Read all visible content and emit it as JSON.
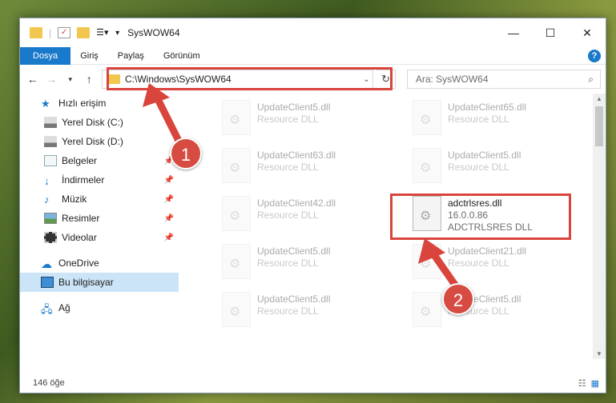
{
  "window": {
    "title": "SysWOW64"
  },
  "ribbon": {
    "tabs": [
      "Dosya",
      "Giriş",
      "Paylaş",
      "Görünüm"
    ]
  },
  "address": {
    "path": "C:\\Windows\\SysWOW64"
  },
  "search": {
    "placeholder": "Ara: SysWOW64"
  },
  "sidebar": {
    "items": [
      {
        "label": "Hızlı erişim",
        "icon": "star-icon"
      },
      {
        "label": "Yerel Disk (C:)",
        "icon": "drive-icon"
      },
      {
        "label": "Yerel Disk (D:)",
        "icon": "drive-icon"
      },
      {
        "label": "Belgeler",
        "icon": "document-icon"
      },
      {
        "label": "İndirmeler",
        "icon": "download-icon"
      },
      {
        "label": "Müzik",
        "icon": "music-icon"
      },
      {
        "label": "Resimler",
        "icon": "pictures-icon"
      },
      {
        "label": "Videolar",
        "icon": "video-icon"
      },
      {
        "label": "OneDrive",
        "icon": "cloud-icon"
      },
      {
        "label": "Bu bilgisayar",
        "icon": "computer-icon"
      },
      {
        "label": "Ağ",
        "icon": "network-icon"
      }
    ]
  },
  "files": [
    {
      "name": "UpdateClient5.dll",
      "desc": "Resource DLL"
    },
    {
      "name": "UpdateClient65.dll",
      "desc": "Resource DLL"
    },
    {
      "name": "UpdateClient63.dll",
      "desc": "Resource DLL"
    },
    {
      "name": "UpdateClient5.dll",
      "desc": "Resource DLL"
    },
    {
      "name": "UpdateClient42.dll",
      "desc": "Resource DLL"
    },
    {
      "name": "adctrlsres.dll",
      "version": "16.0.0.86",
      "desc": "ADCTRLSRES DLL"
    },
    {
      "name": "UpdateClient5.dll",
      "desc": "Resource DLL"
    },
    {
      "name": "UpdateClient21.dll",
      "desc": "Resource DLL"
    },
    {
      "name": "UpdateClient5.dll",
      "desc": "Resource DLL"
    },
    {
      "name": "UpdateClient5.dll",
      "desc": "Resource DLL"
    }
  ],
  "status": {
    "count": "146 öğe"
  },
  "annotations": {
    "step1": "1",
    "step2": "2",
    "color": "#d9453c"
  }
}
